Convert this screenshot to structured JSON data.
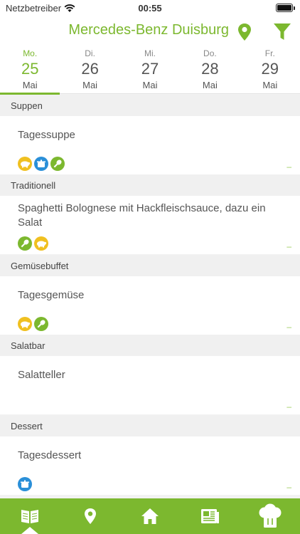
{
  "status": {
    "carrier": "Netzbetreiber",
    "time": "00:55"
  },
  "header": {
    "title": "Mercedes-Benz Duisburg"
  },
  "days": [
    {
      "dow": "Mo.",
      "day": "25",
      "month": "Mai",
      "active": true
    },
    {
      "dow": "Di.",
      "day": "26",
      "month": "Mai",
      "active": false
    },
    {
      "dow": "Mi.",
      "day": "27",
      "month": "Mai",
      "active": false
    },
    {
      "dow": "Do.",
      "day": "28",
      "month": "Mai",
      "active": false
    },
    {
      "dow": "Fr.",
      "day": "29",
      "month": "Mai",
      "active": false
    }
  ],
  "sections": [
    {
      "title": "Suppen",
      "item": {
        "name": "Tagessuppe",
        "icons": [
          "pig-icon",
          "pot-icon",
          "chicken-leg-icon"
        ],
        "dash": "–"
      }
    },
    {
      "title": "Traditionell",
      "item": {
        "name": "Spaghetti Bolognese mit Hackfleischsauce, dazu ein Salat",
        "icons": [
          "chicken-leg-icon",
          "pig-icon"
        ],
        "dash": "–"
      }
    },
    {
      "title": "Gemüsebuffet",
      "item": {
        "name": "Tagesgemüse",
        "icons": [
          "pig-icon",
          "chicken-leg-icon"
        ],
        "dash": "–"
      }
    },
    {
      "title": "Salatbar",
      "item": {
        "name": "Salatteller",
        "icons": [],
        "dash": "–"
      }
    },
    {
      "title": "Dessert",
      "item": {
        "name": "Tagesdessert",
        "icons": [
          "pot-icon"
        ],
        "dash": "–"
      }
    }
  ],
  "tabs": [
    "menu-book-icon",
    "location-pin-icon",
    "home-icon",
    "news-icon",
    "chef-hat-icon"
  ],
  "colors": {
    "accent": "#7cb82f",
    "icon_yellow": "#f0c020",
    "icon_blue": "#2a8fd8"
  }
}
